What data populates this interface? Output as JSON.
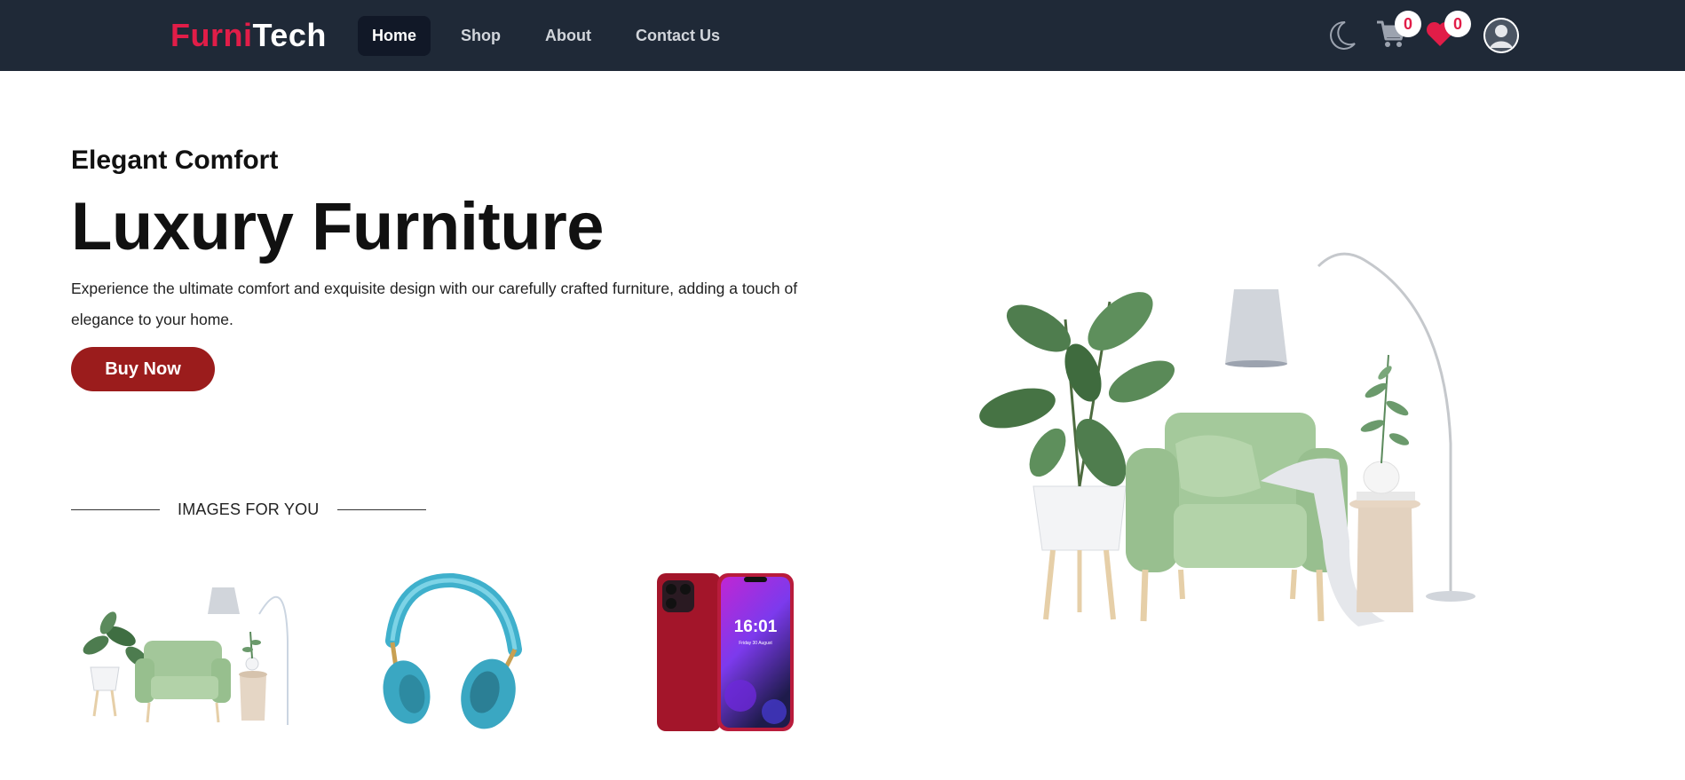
{
  "brand": {
    "part1": "Furni",
    "part2": "Tech"
  },
  "nav": {
    "links": [
      {
        "label": "Home",
        "active": true
      },
      {
        "label": "Shop",
        "active": false
      },
      {
        "label": "About",
        "active": false
      },
      {
        "label": "Contact Us",
        "active": false
      }
    ]
  },
  "header_icons": {
    "theme": "moon-icon",
    "cart": {
      "icon": "cart-icon",
      "count": "0"
    },
    "wishlist": {
      "icon": "heart-icon",
      "count": "0"
    },
    "profile": "user-avatar-icon"
  },
  "hero": {
    "subtitle": "Elegant Comfort",
    "title": "Luxury Furniture",
    "description": "Experience the ultimate comfort and exquisite design with our carefully crafted furniture, adding a touch of elegance to your home.",
    "cta": "Buy Now",
    "image": "armchair-with-plant-and-lamp"
  },
  "gallery": {
    "heading": "IMAGES FOR YOU",
    "items": [
      {
        "image": "armchair-set"
      },
      {
        "image": "headphones"
      },
      {
        "image": "smartphone",
        "screen_time": "16:01",
        "screen_date": "Friday 30 August"
      }
    ]
  },
  "colors": {
    "navbar_bg": "#1f2937",
    "brand_red": "#e11d48",
    "cta_bg": "#9b1c1c",
    "active_tab_bg": "#111827"
  }
}
